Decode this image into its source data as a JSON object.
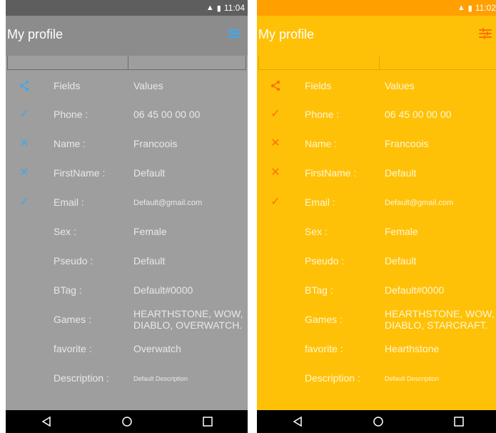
{
  "left": {
    "status": {
      "time": "11:04",
      "signal": "3G"
    },
    "appbar": {
      "title": "My profile",
      "settings_icon": "tune-icon"
    },
    "header": {
      "fields": "Fields",
      "values": "Values"
    },
    "rows": [
      {
        "label": "Phone :",
        "value": "06 45 00 00 00",
        "icon": "check"
      },
      {
        "label": "Name :",
        "value": "Francoois",
        "icon": "cross"
      },
      {
        "label": "FirstName :",
        "value": "Default",
        "icon": "cross"
      },
      {
        "label": "Email :",
        "value": "Default@gmail.com",
        "icon": "check"
      },
      {
        "label": "Sex :",
        "value": "Female",
        "icon": ""
      },
      {
        "label": "Pseudo :",
        "value": "Default",
        "icon": ""
      },
      {
        "label": "BTag :",
        "value": "Default#0000",
        "icon": ""
      },
      {
        "label": "Games :",
        "value": "HEARTHSTONE, WOW,\nDIABLO, OVERWATCH.",
        "icon": ""
      },
      {
        "label": "favorite :",
        "value": "Overwatch",
        "icon": ""
      },
      {
        "label": "Description :",
        "value": "Default Description",
        "icon": ""
      }
    ],
    "colors": {
      "status": "#5e5e5e",
      "bg": "#9e9e9e",
      "accent": "#41a8ea"
    }
  },
  "right": {
    "status": {
      "time": "11:02",
      "signal": "3G"
    },
    "appbar": {
      "title": "My profile",
      "settings_icon": "tune-icon"
    },
    "header": {
      "fields": "Fields",
      "values": "Values"
    },
    "rows": [
      {
        "label": "Phone :",
        "value": "06 45 00 00 00",
        "icon": "check"
      },
      {
        "label": "Name :",
        "value": "Francoois",
        "icon": "cross"
      },
      {
        "label": "FirstName :",
        "value": "Default",
        "icon": "cross"
      },
      {
        "label": "Email :",
        "value": "Default@gmail.com",
        "icon": "check"
      },
      {
        "label": "Sex :",
        "value": "Female",
        "icon": ""
      },
      {
        "label": "Pseudo :",
        "value": "Default",
        "icon": ""
      },
      {
        "label": "BTag :",
        "value": "Default#0000",
        "icon": ""
      },
      {
        "label": "Games :",
        "value": "HEARTHSTONE, WOW,\nDIABLO, STARCRAFT.",
        "icon": ""
      },
      {
        "label": "favorite :",
        "value": "Hearthstone",
        "icon": ""
      },
      {
        "label": "Description :",
        "value": "Default Description",
        "icon": ""
      }
    ],
    "colors": {
      "status": "#ffa000",
      "bg": "#ffc107",
      "accent": "#ff6f00"
    }
  }
}
